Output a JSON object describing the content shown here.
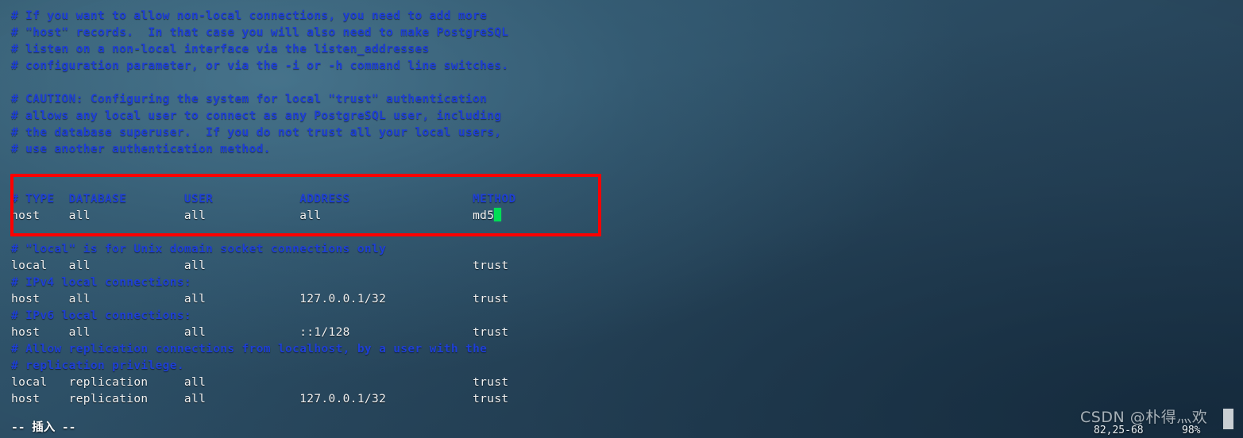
{
  "terminal": {
    "background_color": "#2d5067",
    "comment_color": "#1e3fd6",
    "code_color": "#f2f2f2",
    "cursor_color": "#00dd55",
    "annotation_color": "#fe0000"
  },
  "buffer": {
    "lines": [
      {
        "text": "#",
        "kind": "comment"
      },
      {
        "text": "# If you want to allow non-local connections, you need to add more",
        "kind": "comment"
      },
      {
        "text": "# \"host\" records.  In that case you will also need to make PostgreSQL",
        "kind": "comment"
      },
      {
        "text": "# listen on a non-local interface via the listen_addresses",
        "kind": "comment"
      },
      {
        "text": "# configuration parameter, or via the -i or -h command line switches.",
        "kind": "comment"
      },
      {
        "text": "",
        "kind": "blank"
      },
      {
        "text": "# CAUTION: Configuring the system for local \"trust\" authentication",
        "kind": "comment"
      },
      {
        "text": "# allows any local user to connect as any PostgreSQL user, including",
        "kind": "comment"
      },
      {
        "text": "# the database superuser.  If you do not trust all your local users,",
        "kind": "comment"
      },
      {
        "text": "# use another authentication method.",
        "kind": "comment"
      },
      {
        "text": "",
        "kind": "blank"
      },
      {
        "text": "",
        "kind": "blank"
      },
      {
        "text": "# TYPE  DATABASE        USER            ADDRESS                 METHOD",
        "kind": "comment"
      },
      {
        "text": "host    all             all             all                     md5",
        "kind": "code",
        "cursor_after": true
      },
      {
        "text": "",
        "kind": "blank"
      },
      {
        "text": "# \"local\" is for Unix domain socket connections only",
        "kind": "comment"
      },
      {
        "text": "local   all             all                                     trust",
        "kind": "code"
      },
      {
        "text": "# IPv4 local connections:",
        "kind": "comment"
      },
      {
        "text": "host    all             all             127.0.0.1/32            trust",
        "kind": "code"
      },
      {
        "text": "# IPv6 local connections:",
        "kind": "comment"
      },
      {
        "text": "host    all             all             ::1/128                 trust",
        "kind": "code"
      },
      {
        "text": "# Allow replication connections from localhost, by a user with the",
        "kind": "comment"
      },
      {
        "text": "# replication privilege.",
        "kind": "comment"
      },
      {
        "text": "local   replication     all                                     trust",
        "kind": "code"
      },
      {
        "text": "host    replication     all             127.0.0.1/32            trust",
        "kind": "code"
      }
    ]
  },
  "statusline": {
    "mode": "-- 插入 --",
    "ruler_position": "82,25-68",
    "ruler_percent": "98%"
  },
  "annotation": {
    "label": "highlight-host-all-all-all-md5"
  },
  "watermark": {
    "text": "CSDN @朴得灬欢"
  }
}
